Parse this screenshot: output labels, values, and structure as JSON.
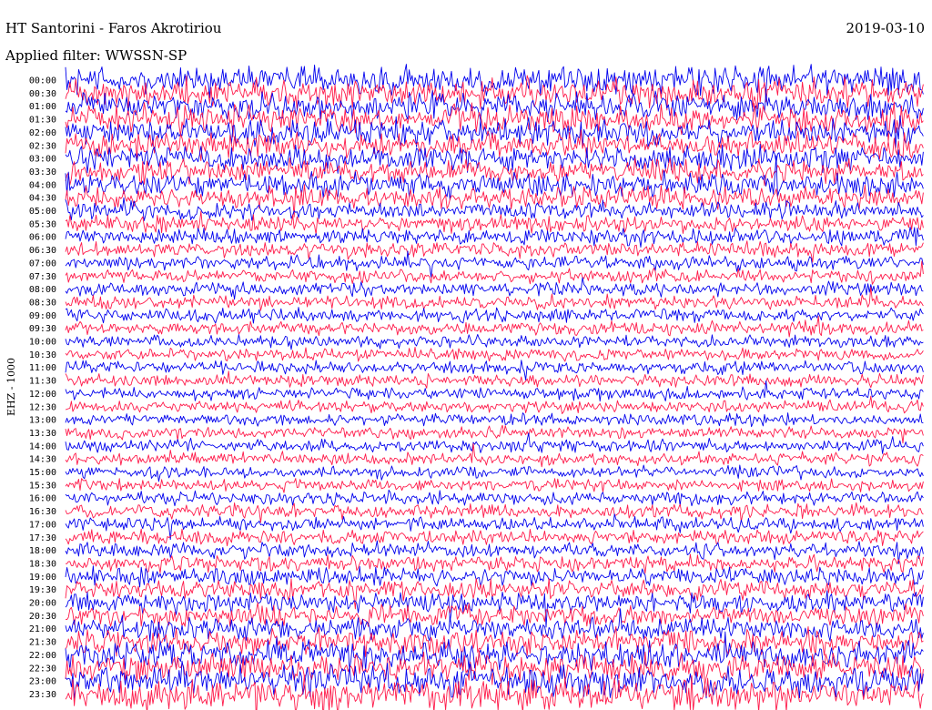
{
  "header": {
    "station_title": "HT Santorini - Faros Akrotiriou",
    "date": "2019-03-10",
    "filter_text": "Applied filter: WWSSN-SP"
  },
  "chart_data": {
    "type": "line",
    "channel_label": "EHZ - 1000",
    "trace_colors": [
      "#0000ee",
      "#ff1a4a"
    ],
    "tick_labels": [
      "00:00",
      "00:30",
      "01:00",
      "01:30",
      "02:00",
      "02:30",
      "03:00",
      "03:30",
      "04:00",
      "04:30",
      "05:00",
      "05:30",
      "06:00",
      "06:30",
      "07:00",
      "07:30",
      "08:00",
      "08:30",
      "09:00",
      "09:30",
      "10:00",
      "10:30",
      "11:00",
      "11:30",
      "12:00",
      "12:30",
      "13:00",
      "13:30",
      "14:00",
      "14:30",
      "15:00",
      "15:30",
      "16:00",
      "16:30",
      "17:00",
      "17:30",
      "18:00",
      "18:30",
      "19:00",
      "19:30",
      "20:00",
      "20:30",
      "21:00",
      "21:30",
      "22:00",
      "22:30",
      "23:00",
      "23:30"
    ],
    "relative_amplitude": [
      1.0,
      0.95,
      0.95,
      0.95,
      0.9,
      0.85,
      0.85,
      0.8,
      0.8,
      0.7,
      0.6,
      0.55,
      0.55,
      0.5,
      0.45,
      0.45,
      0.45,
      0.45,
      0.45,
      0.45,
      0.4,
      0.4,
      0.4,
      0.4,
      0.4,
      0.4,
      0.4,
      0.4,
      0.4,
      0.4,
      0.4,
      0.4,
      0.45,
      0.45,
      0.45,
      0.5,
      0.5,
      0.55,
      0.6,
      0.65,
      0.7,
      0.7,
      0.75,
      0.85,
      0.95,
      1.0,
      1.05,
      1.1
    ],
    "grid": false
  }
}
